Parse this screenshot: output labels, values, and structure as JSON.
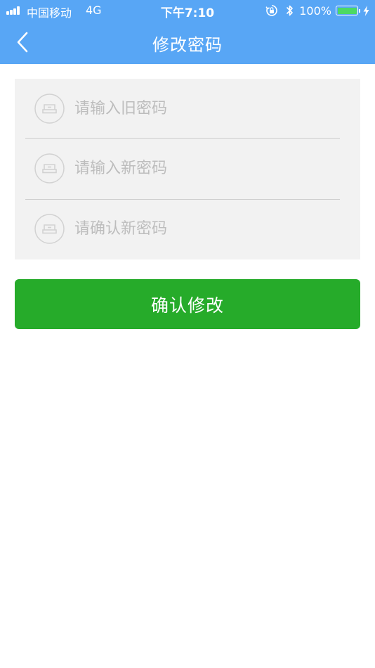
{
  "status_bar": {
    "carrier": "中国移动",
    "network": "4G",
    "time": "下午7:10",
    "battery_percent_label": "100%",
    "battery_level": 1.0,
    "battery_fill_color": "#4cd964",
    "icons": [
      "signal-bars-icon",
      "orientation-lock-icon",
      "bluetooth-icon",
      "battery-icon",
      "charging-bolt-icon"
    ]
  },
  "nav": {
    "title": "修改密码",
    "back_icon": "chevron-left-icon",
    "background_color": "#58a6f5"
  },
  "form": {
    "fields": [
      {
        "name": "old-password",
        "placeholder": "请输入旧密码",
        "value": "",
        "icon": "lock-icon"
      },
      {
        "name": "new-password",
        "placeholder": "请输入新密码",
        "value": "",
        "icon": "lock-icon"
      },
      {
        "name": "confirm-password",
        "placeholder": "请确认新密码",
        "value": "",
        "icon": "lock-icon"
      }
    ],
    "submit_label": "确认修改",
    "submit_color": "#26ab2a"
  }
}
